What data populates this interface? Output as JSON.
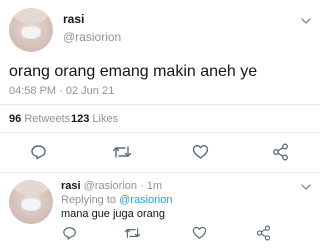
{
  "tweet": {
    "name": "rasi",
    "handle": "@rasiorion",
    "text": "orang orang emang makin aneh ye",
    "time": "04:58 PM",
    "separator": "·",
    "date": "02 Jun 21",
    "retweets_count": "96",
    "retweets_label": "Retweets",
    "likes_count": "123",
    "likes_label": "Likes"
  },
  "reply": {
    "name": "rasi",
    "handle": "@rasiorion",
    "separator": "·",
    "age": "1m",
    "replying_prefix": "Replying to",
    "replying_handle": "@rasiorion",
    "text": "mana gue juga orang"
  },
  "icons": {
    "reply": "reply-icon",
    "retweet": "retweet-icon",
    "like": "heart-icon",
    "share": "share-icon",
    "menu": "chevron-down-icon"
  },
  "colors": {
    "text": "#14171a",
    "muted": "#8a949c",
    "link": "#1da1f2",
    "divider": "#e6ecf0"
  }
}
